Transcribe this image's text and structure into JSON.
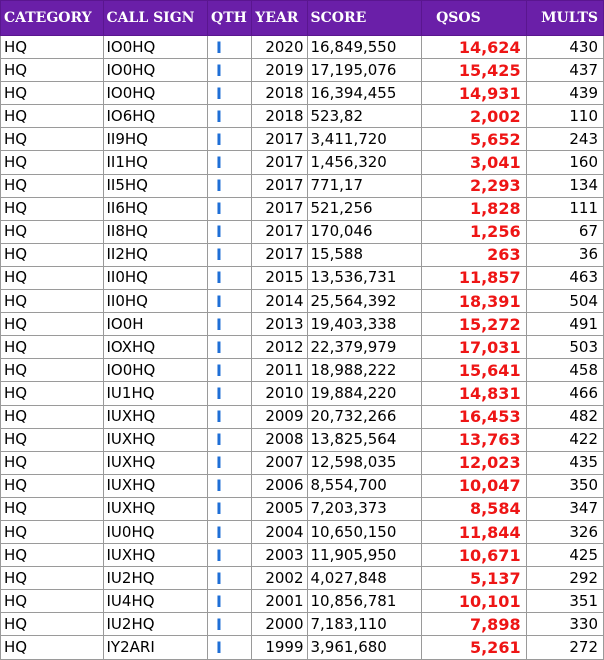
{
  "colors": {
    "header_bg": "#6a1fa8",
    "header_text": "#ffffff",
    "qth_text": "#1f6fd6",
    "qsos_text": "#ee1515",
    "grid_line": "#9a9a9a"
  },
  "headers": {
    "category": "CATEGORY",
    "call_sign": "CALL SIGN",
    "qth": "QTH",
    "year": "YEAR",
    "score": "SCORE",
    "qsos": "QSOS",
    "mults": "MULTS"
  },
  "rows": [
    {
      "category": "HQ",
      "call_sign": "IO0HQ",
      "qth": "I",
      "year": "2020",
      "score": "16,849,550",
      "qsos": "14,624",
      "mults": "430"
    },
    {
      "category": "HQ",
      "call_sign": "IO0HQ",
      "qth": "I",
      "year": "2019",
      "score": "17,195,076",
      "qsos": "15,425",
      "mults": "437"
    },
    {
      "category": "HQ",
      "call_sign": "IO0HQ",
      "qth": "I",
      "year": "2018",
      "score": "16,394,455",
      "qsos": "14,931",
      "mults": "439"
    },
    {
      "category": "HQ",
      "call_sign": "IO6HQ",
      "qth": "I",
      "year": "2018",
      "score": "523,82",
      "qsos": "2,002",
      "mults": "110"
    },
    {
      "category": "HQ",
      "call_sign": "II9HQ",
      "qth": "I",
      "year": "2017",
      "score": "3,411,720",
      "qsos": "5,652",
      "mults": "243"
    },
    {
      "category": "HQ",
      "call_sign": "II1HQ",
      "qth": "I",
      "year": "2017",
      "score": "1,456,320",
      "qsos": "3,041",
      "mults": "160"
    },
    {
      "category": "HQ",
      "call_sign": "II5HQ",
      "qth": "I",
      "year": "2017",
      "score": "771,17",
      "qsos": "2,293",
      "mults": "134"
    },
    {
      "category": "HQ",
      "call_sign": "II6HQ",
      "qth": "I",
      "year": "2017",
      "score": "521,256",
      "qsos": "1,828",
      "mults": "111"
    },
    {
      "category": "HQ",
      "call_sign": "II8HQ",
      "qth": "I",
      "year": "2017",
      "score": "170,046",
      "qsos": "1,256",
      "mults": "67"
    },
    {
      "category": "HQ",
      "call_sign": "II2HQ",
      "qth": "I",
      "year": "2017",
      "score": "15,588",
      "qsos": "263",
      "mults": "36"
    },
    {
      "category": "HQ",
      "call_sign": "II0HQ",
      "qth": "I",
      "year": "2015",
      "score": "13,536,731",
      "qsos": "11,857",
      "mults": "463"
    },
    {
      "category": "HQ",
      "call_sign": "II0HQ",
      "qth": "I",
      "year": "2014",
      "score": "25,564,392",
      "qsos": "18,391",
      "mults": "504"
    },
    {
      "category": "HQ",
      "call_sign": "IO0H",
      "qth": "I",
      "year": "2013",
      "score": "19,403,338",
      "qsos": "15,272",
      "mults": "491"
    },
    {
      "category": "HQ",
      "call_sign": "IOXHQ",
      "qth": "I",
      "year": "2012",
      "score": "22,379,979",
      "qsos": "17,031",
      "mults": "503"
    },
    {
      "category": "HQ",
      "call_sign": "IO0HQ",
      "qth": "I",
      "year": "2011",
      "score": "18,988,222",
      "qsos": "15,641",
      "mults": "458"
    },
    {
      "category": "HQ",
      "call_sign": "IU1HQ",
      "qth": "I",
      "year": "2010",
      "score": "19,884,220",
      "qsos": "14,831",
      "mults": "466"
    },
    {
      "category": "HQ",
      "call_sign": "IUXHQ",
      "qth": "I",
      "year": "2009",
      "score": "20,732,266",
      "qsos": "16,453",
      "mults": "482"
    },
    {
      "category": "HQ",
      "call_sign": "IUXHQ",
      "qth": "I",
      "year": "2008",
      "score": "13,825,564",
      "qsos": "13,763",
      "mults": "422"
    },
    {
      "category": "HQ",
      "call_sign": "IUXHQ",
      "qth": "I",
      "year": "2007",
      "score": "12,598,035",
      "qsos": "12,023",
      "mults": "435"
    },
    {
      "category": "HQ",
      "call_sign": "IUXHQ",
      "qth": "I",
      "year": "2006",
      "score": "8,554,700",
      "qsos": "10,047",
      "mults": "350"
    },
    {
      "category": "HQ",
      "call_sign": "IUXHQ",
      "qth": "I",
      "year": "2005",
      "score": "7,203,373",
      "qsos": "8,584",
      "mults": "347"
    },
    {
      "category": "HQ",
      "call_sign": "IU0HQ",
      "qth": "I",
      "year": "2004",
      "score": "10,650,150",
      "qsos": "11,844",
      "mults": "326"
    },
    {
      "category": "HQ",
      "call_sign": "IUXHQ",
      "qth": "I",
      "year": "2003",
      "score": "11,905,950",
      "qsos": "10,671",
      "mults": "425"
    },
    {
      "category": "HQ",
      "call_sign": "IU2HQ",
      "qth": "I",
      "year": "2002",
      "score": "4,027,848",
      "qsos": "5,137",
      "mults": "292"
    },
    {
      "category": "HQ",
      "call_sign": "IU4HQ",
      "qth": "I",
      "year": "2001",
      "score": "10,856,781",
      "qsos": "10,101",
      "mults": "351"
    },
    {
      "category": "HQ",
      "call_sign": "IU2HQ",
      "qth": "I",
      "year": "2000",
      "score": "7,183,110",
      "qsos": "7,898",
      "mults": "330"
    },
    {
      "category": "HQ",
      "call_sign": "IY2ARI",
      "qth": "I",
      "year": "1999",
      "score": "3,961,680",
      "qsos": "5,261",
      "mults": "272"
    }
  ]
}
